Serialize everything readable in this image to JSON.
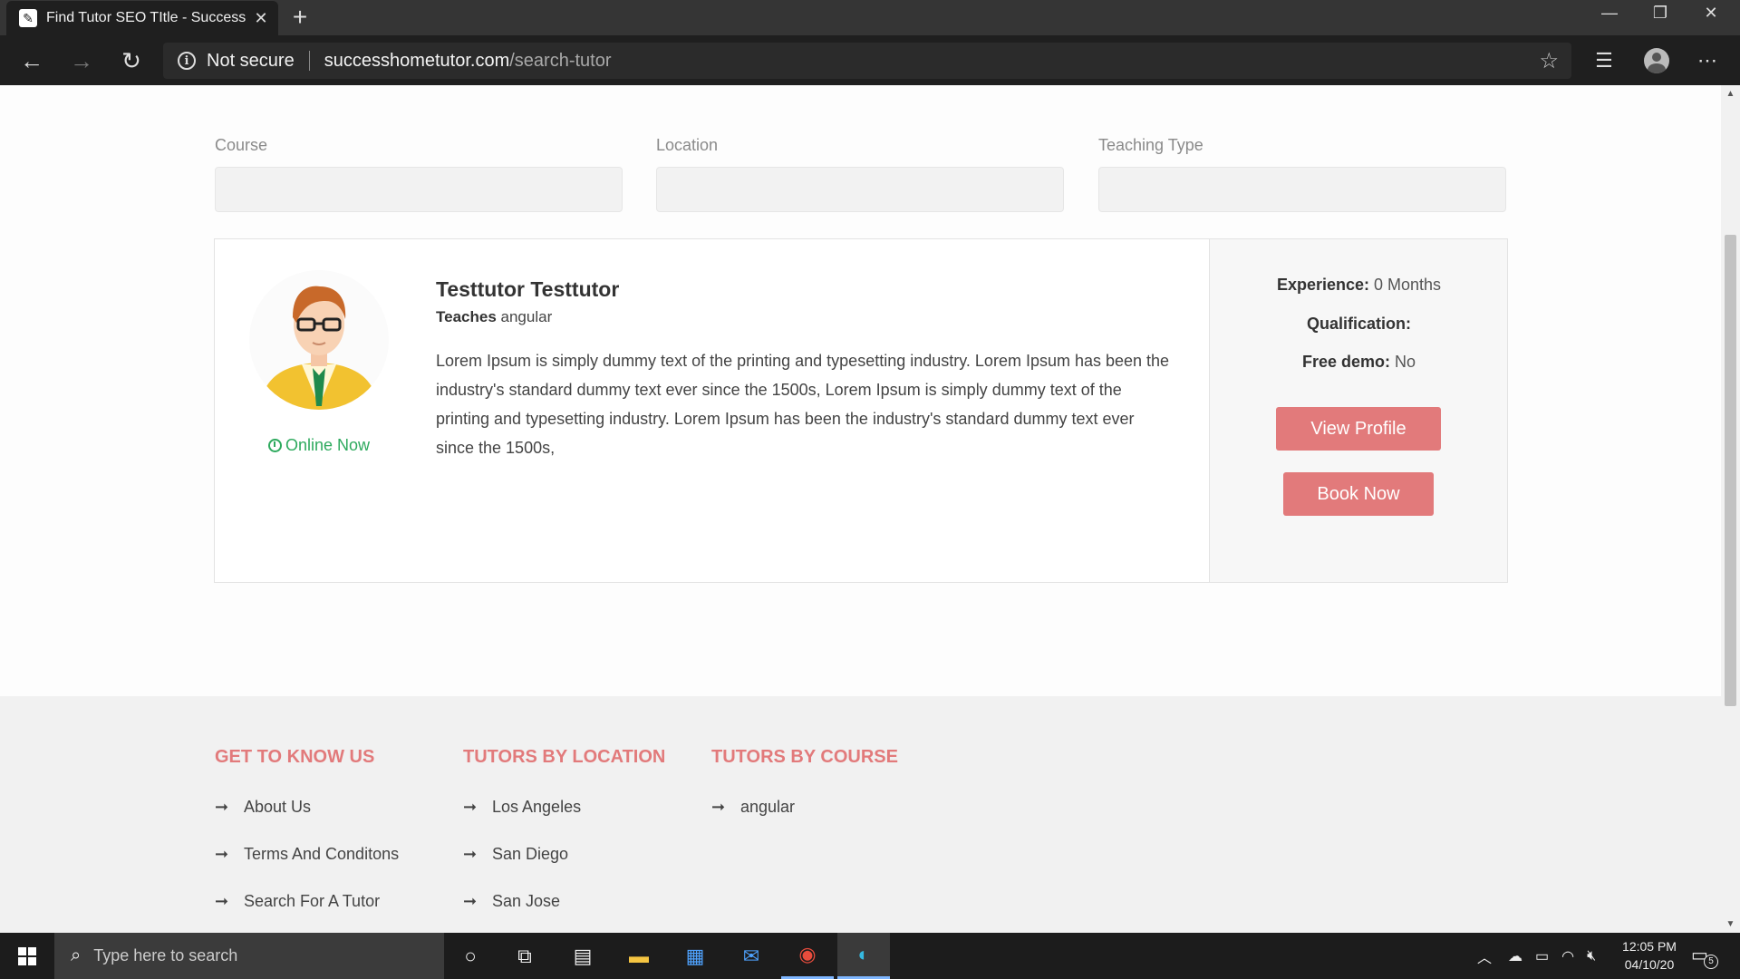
{
  "browser": {
    "tab_title": "Find Tutor SEO TItle - Success Ho",
    "security_label": "Not secure",
    "url_host": "successhometutor.com",
    "url_path": "/search-tutor"
  },
  "filters": {
    "course_label": "Course",
    "location_label": "Location",
    "teaching_type_label": "Teaching Type",
    "course_value": "",
    "location_value": "",
    "teaching_type_value": ""
  },
  "tutor": {
    "name": "Testtutor Testtutor",
    "teaches_label": "Teaches",
    "teaches_value": "angular",
    "status": "Online Now",
    "bio": "Lorem Ipsum is simply dummy text of the printing and typesetting industry. Lorem Ipsum has been the industry's standard dummy text ever since the 1500s, Lorem Ipsum is simply dummy text of the printing and typesetting industry. Lorem Ipsum has been the industry's standard dummy text ever since the 1500s,",
    "experience_label": "Experience:",
    "experience_value": "0 Months",
    "qualification_label": "Qualification:",
    "qualification_value": "",
    "free_demo_label": "Free demo:",
    "free_demo_value": "No",
    "view_profile_label": "View Profile",
    "book_now_label": "Book Now"
  },
  "footer": {
    "col1_title": "GET TO KNOW US",
    "col1_items": [
      "About Us",
      "Terms And Conditons",
      "Search For A Tutor"
    ],
    "col2_title": "TUTORS BY LOCATION",
    "col2_items": [
      "Los Angeles",
      "San Diego",
      "San Jose"
    ],
    "col3_title": "TUTORS BY COURSE",
    "col3_items": [
      "angular"
    ]
  },
  "taskbar": {
    "search_placeholder": "Type here to search",
    "time": "12:05 PM",
    "date": "04/10/20",
    "notification_count": "5"
  },
  "colors": {
    "accent": "#e27a7b",
    "online": "#2eaa5e"
  }
}
